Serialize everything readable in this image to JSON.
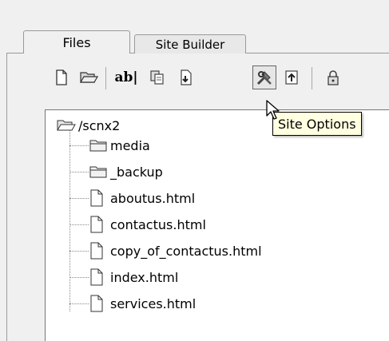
{
  "tabs": [
    {
      "label": "Files"
    },
    {
      "label": "Site Builder"
    }
  ],
  "toolbar": {
    "buttons": [
      {
        "icon": "new-file-icon"
      },
      {
        "icon": "open-folder-icon"
      },
      {
        "icon": "rename-icon",
        "label": "ab|"
      },
      {
        "icon": "copy-icon"
      },
      {
        "icon": "download-icon"
      },
      {
        "icon": "site-options-icon"
      },
      {
        "icon": "upload-icon"
      },
      {
        "icon": "lock-icon"
      }
    ]
  },
  "tooltip": {
    "text": "Site Options"
  },
  "tree": {
    "root": "/scnx2",
    "folders": [
      "media",
      "_backup"
    ],
    "files": [
      "aboutus.html",
      "contactus.html",
      "copy_of_contactus.html",
      "index.html",
      "services.html"
    ]
  },
  "colors": {
    "background": "#f0f0f0",
    "tooltip_bg": "#ffffe1",
    "tree_bg": "#ffffff"
  }
}
